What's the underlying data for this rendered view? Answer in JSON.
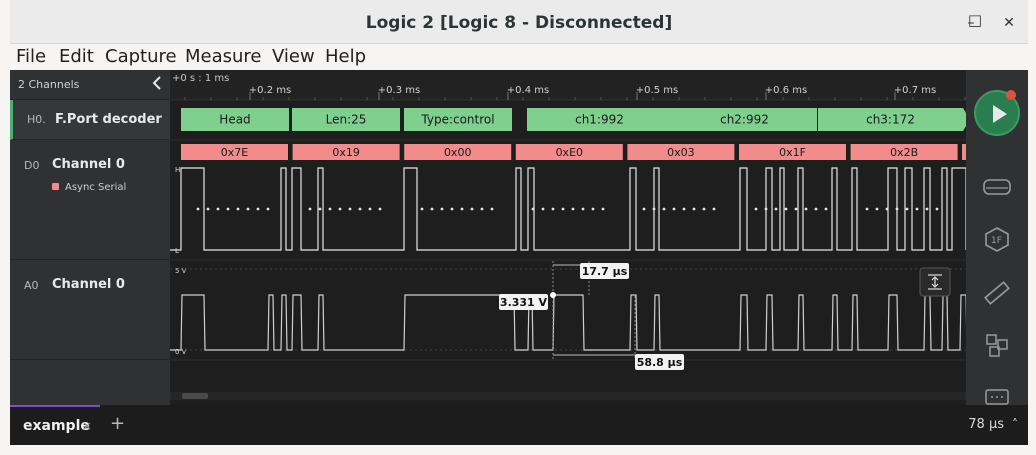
{
  "window": {
    "title": "Logic 2 [Logic 8 - Disconnected]",
    "controls": {
      "minimize": "–",
      "maximize": "□",
      "close": "✕"
    }
  },
  "menu": [
    "File",
    "Edit",
    "Capture",
    "Measure",
    "View",
    "Help"
  ],
  "sidebar": {
    "channels_count": "2 Channels",
    "collapse_icon": "chevron-left-icon",
    "rows": [
      {
        "id": "H0.",
        "name": "F.Port decoder"
      },
      {
        "id": "D0",
        "name": "Channel 0",
        "analyzer": "Async Serial",
        "analyzer_color": "#f28b8b"
      },
      {
        "id": "A0",
        "name": "Channel 0"
      }
    ]
  },
  "timeline": {
    "origin": "+0 s : 1 ms",
    "ticks": [
      "+0.2 ms",
      "+0.3 ms",
      "+0.4 ms",
      "+0.5 ms",
      "+0.6 ms",
      "+0.7 ms"
    ]
  },
  "decoder": {
    "color": "#7fcf8f",
    "frames": [
      "Head",
      "Len:25",
      "Type:control",
      "ch1:992",
      "ch2:992",
      "ch3:172"
    ]
  },
  "async_bytes": {
    "color": "#f28b8b",
    "values": [
      "0x7E",
      "0x19",
      "0x00",
      "0xE0",
      "0x03",
      "0x1F",
      "0x2B"
    ]
  },
  "digital": {
    "high_label": "H",
    "low_label": "L"
  },
  "analog": {
    "top_label": "5 V",
    "bottom_label": "0 V"
  },
  "measurements": {
    "voltage": "3.331 V",
    "pulse_width": "17.7 µs",
    "period": "58.8 µs"
  },
  "tabs": [
    {
      "label": "example",
      "close": "×"
    }
  ],
  "tab_add": "+",
  "zoom": {
    "level": "78 µs",
    "caret": "˄"
  },
  "icons": [
    "play-icon",
    "record-indicator-icon",
    "analyzers-icon",
    "1f-extensions-icon",
    "measure-ruler-icon",
    "layout-icon",
    "chat-icon",
    "fit-vertical-icon"
  ]
}
